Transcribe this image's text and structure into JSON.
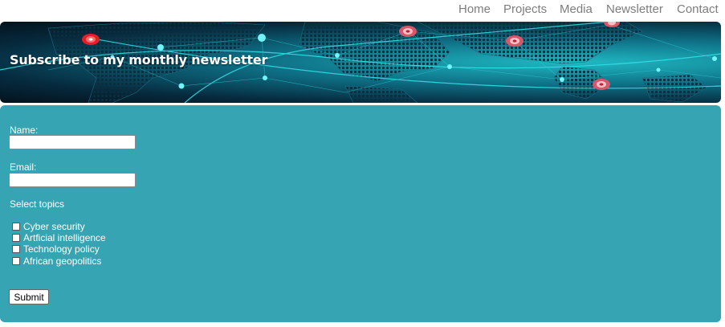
{
  "nav": {
    "items": [
      {
        "label": "Home"
      },
      {
        "label": "Projects"
      },
      {
        "label": "Media"
      },
      {
        "label": "Newsletter"
      },
      {
        "label": "Contact"
      }
    ]
  },
  "banner": {
    "title": "Subscribe to my monthly newsletter",
    "image": "world-map-network-icon"
  },
  "form": {
    "name_label": "Name:",
    "name_value": "",
    "email_label": "Email:",
    "email_value": "",
    "topics_heading": "Select topics",
    "topics": [
      {
        "label": "Cyber security",
        "checked": false
      },
      {
        "label": "Artficial intelligence",
        "checked": false
      },
      {
        "label": "Technology policy",
        "checked": false
      },
      {
        "label": "African geopolitics",
        "checked": false
      }
    ],
    "submit_label": "Submit"
  },
  "colors": {
    "panel_bg": "#36a4b2",
    "nav_text": "#7d7d7d",
    "banner_accent": "#1fd2dc",
    "pin_color": "#e04050"
  }
}
